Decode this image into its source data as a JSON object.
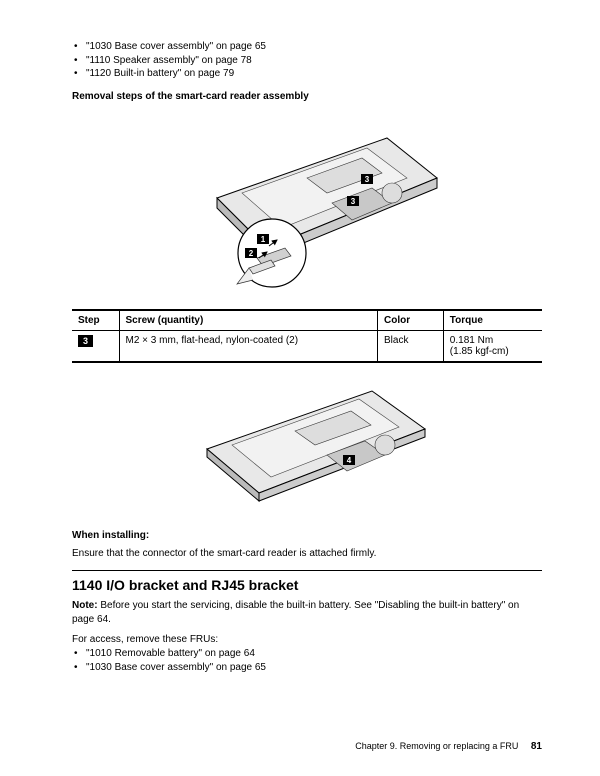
{
  "top_bullets": [
    "\"1030 Base cover assembly\" on page 65",
    "\"1110 Speaker assembly\" on page 78",
    "\"1120 Built-in battery\" on page 79"
  ],
  "removal_heading": "Removal steps of the smart-card reader assembly",
  "screw_table": {
    "headers": {
      "step": "Step",
      "screw": "Screw (quantity)",
      "color": "Color",
      "torque": "Torque"
    },
    "rows": [
      {
        "step": "3",
        "screw": "M2 × 3 mm, flat-head, nylon-coated (2)",
        "color": "Black",
        "torque": "0.181 Nm",
        "torque_sub": "(1.85 kgf-cm)"
      }
    ]
  },
  "installing_heading": "When installing:",
  "installing_text": "Ensure that the connector of the smart-card reader is attached firmly.",
  "section_title": "1140 I/O bracket and RJ45 bracket",
  "note_label": "Note:",
  "note_text": " Before you start the servicing, disable the built-in battery. See \"Disabling the built-in battery\" on page 64.",
  "access_line": "For access, remove these FRUs:",
  "access_bullets": [
    "\"1010 Removable battery\" on page 64",
    "\"1030 Base cover assembly\" on page 65"
  ],
  "footer_chapter": "Chapter 9. Removing or replacing a FRU",
  "footer_page": "81",
  "diagram_callouts": {
    "c1": "1",
    "c2": "2",
    "c3a": "3",
    "c3b": "3",
    "c4": "4"
  }
}
